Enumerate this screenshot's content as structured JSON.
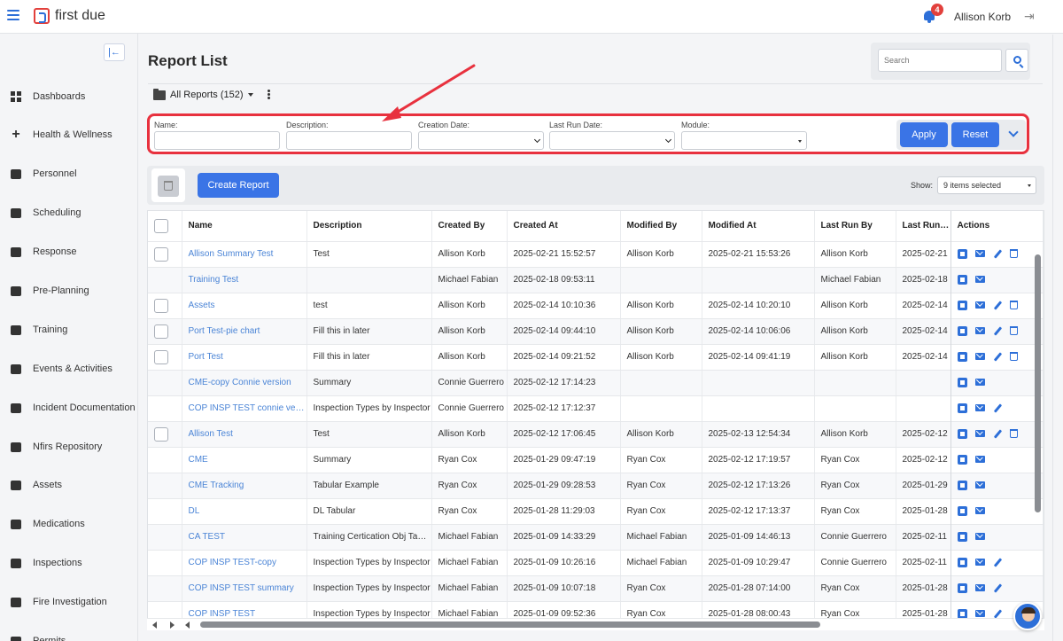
{
  "app": {
    "brand": "first due",
    "user": "Allison Korb",
    "notifications": "4"
  },
  "sidebar": {
    "items": [
      {
        "label": "Dashboards",
        "icon": "dashboard-icon"
      },
      {
        "label": "Health & Wellness",
        "icon": "plus-icon"
      },
      {
        "label": "Personnel",
        "icon": "people-icon"
      },
      {
        "label": "Scheduling",
        "icon": "calendar-icon"
      },
      {
        "label": "Response",
        "icon": "response-icon"
      },
      {
        "label": "Pre-Planning",
        "icon": "map-icon"
      },
      {
        "label": "Training",
        "icon": "training-icon"
      },
      {
        "label": "Events & Activities",
        "icon": "event-icon"
      },
      {
        "label": "Incident Documentation",
        "icon": "document-icon"
      },
      {
        "label": "Nfirs Repository",
        "icon": "repository-icon"
      },
      {
        "label": "Assets",
        "icon": "truck-icon"
      },
      {
        "label": "Medications",
        "icon": "syringe-icon"
      },
      {
        "label": "Inspections",
        "icon": "checklist-icon"
      },
      {
        "label": "Fire Investigation",
        "icon": "investigation-icon"
      },
      {
        "label": "Permits",
        "icon": "permit-icon"
      }
    ]
  },
  "page": {
    "title": "Report List",
    "search_placeholder": "Search",
    "folder": "All Reports (152)"
  },
  "filters": {
    "name_label": "Name:",
    "description_label": "Description:",
    "creation_date_label": "Creation Date:",
    "last_run_date_label": "Last Run Date:",
    "module_label": "Module:",
    "apply": "Apply",
    "reset": "Reset"
  },
  "toolbar": {
    "create": "Create Report",
    "show_label": "Show:",
    "show_value": "9 items selected"
  },
  "table": {
    "headers": [
      "Name",
      "Description",
      "Created By",
      "Created At",
      "Modified By",
      "Modified At",
      "Last Run By",
      "Last Run At",
      "Actions"
    ],
    "rows": [
      {
        "cb": true,
        "name": "Allison Summary Test",
        "desc": "Test",
        "created_by": "Allison Korb",
        "created_at": "2025-02-21 15:52:57",
        "modified_by": "Allison Korb",
        "modified_at": "2025-02-21 15:53:26",
        "last_run_by": "Allison Korb",
        "last_run_at": "2025-02-21",
        "actions": [
          "copy",
          "mail",
          "edit",
          "delete"
        ]
      },
      {
        "cb": false,
        "name": "Training Test",
        "desc": "",
        "created_by": "Michael Fabian",
        "created_at": "2025-02-18 09:53:11",
        "modified_by": "",
        "modified_at": "",
        "last_run_by": "Michael Fabian",
        "last_run_at": "2025-02-18",
        "actions": [
          "copy",
          "mail"
        ]
      },
      {
        "cb": true,
        "name": "Assets",
        "desc": "test",
        "created_by": "Allison Korb",
        "created_at": "2025-02-14 10:10:36",
        "modified_by": "Allison Korb",
        "modified_at": "2025-02-14 10:20:10",
        "last_run_by": "Allison Korb",
        "last_run_at": "2025-02-14",
        "actions": [
          "copy",
          "mail",
          "edit",
          "delete"
        ]
      },
      {
        "cb": true,
        "name": "Port Test-pie chart",
        "desc": "Fill this in later",
        "created_by": "Allison Korb",
        "created_at": "2025-02-14 09:44:10",
        "modified_by": "Allison Korb",
        "modified_at": "2025-02-14 10:06:06",
        "last_run_by": "Allison Korb",
        "last_run_at": "2025-02-14",
        "actions": [
          "copy",
          "mail",
          "edit",
          "delete"
        ]
      },
      {
        "cb": true,
        "name": "Port Test",
        "desc": "Fill this in later",
        "created_by": "Allison Korb",
        "created_at": "2025-02-14 09:21:52",
        "modified_by": "Allison Korb",
        "modified_at": "2025-02-14 09:41:19",
        "last_run_by": "Allison Korb",
        "last_run_at": "2025-02-14",
        "actions": [
          "copy",
          "mail",
          "edit",
          "delete"
        ]
      },
      {
        "cb": false,
        "name": "CME-copy Connie version",
        "desc": "Summary",
        "created_by": "Connie Guerrero",
        "created_at": "2025-02-12 17:14:23",
        "modified_by": "",
        "modified_at": "",
        "last_run_by": "",
        "last_run_at": "",
        "actions": [
          "copy",
          "mail"
        ]
      },
      {
        "cb": false,
        "name": "COP INSP TEST connie version",
        "desc": "Inspection Types by Inspector",
        "created_by": "Connie Guerrero",
        "created_at": "2025-02-12 17:12:37",
        "modified_by": "",
        "modified_at": "",
        "last_run_by": "",
        "last_run_at": "",
        "actions": [
          "copy",
          "mail",
          "edit"
        ]
      },
      {
        "cb": true,
        "name": "Allison Test",
        "desc": "Test",
        "created_by": "Allison Korb",
        "created_at": "2025-02-12 17:06:45",
        "modified_by": "Allison Korb",
        "modified_at": "2025-02-13 12:54:34",
        "last_run_by": "Allison Korb",
        "last_run_at": "2025-02-12",
        "actions": [
          "copy",
          "mail",
          "edit",
          "delete"
        ]
      },
      {
        "cb": false,
        "name": "CME",
        "desc": "Summary",
        "created_by": "Ryan Cox",
        "created_at": "2025-01-29 09:47:19",
        "modified_by": "Ryan Cox",
        "modified_at": "2025-02-12 17:19:57",
        "last_run_by": "Ryan Cox",
        "last_run_at": "2025-02-12",
        "actions": [
          "copy",
          "mail"
        ]
      },
      {
        "cb": false,
        "name": "CME Tracking",
        "desc": "Tabular Example",
        "created_by": "Ryan Cox",
        "created_at": "2025-01-29 09:28:53",
        "modified_by": "Ryan Cox",
        "modified_at": "2025-02-12 17:13:26",
        "last_run_by": "Ryan Cox",
        "last_run_at": "2025-01-29",
        "actions": [
          "copy",
          "mail"
        ]
      },
      {
        "cb": false,
        "name": "DL",
        "desc": "DL Tabular",
        "created_by": "Ryan Cox",
        "created_at": "2025-01-28 11:29:03",
        "modified_by": "Ryan Cox",
        "modified_at": "2025-02-12 17:13:37",
        "last_run_by": "Ryan Cox",
        "last_run_at": "2025-01-28",
        "actions": [
          "copy",
          "mail"
        ]
      },
      {
        "cb": false,
        "name": "CA TEST",
        "desc": "Training Certication Obj Tabular",
        "created_by": "Michael Fabian",
        "created_at": "2025-01-09 14:33:29",
        "modified_by": "Michael Fabian",
        "modified_at": "2025-01-09 14:46:13",
        "last_run_by": "Connie Guerrero",
        "last_run_at": "2025-02-11",
        "actions": [
          "copy",
          "mail"
        ]
      },
      {
        "cb": false,
        "name": "COP INSP TEST-copy",
        "desc": "Inspection Types by Inspector",
        "created_by": "Michael Fabian",
        "created_at": "2025-01-09 10:26:16",
        "modified_by": "Michael Fabian",
        "modified_at": "2025-01-09 10:29:47",
        "last_run_by": "Connie Guerrero",
        "last_run_at": "2025-02-11",
        "actions": [
          "copy",
          "mail",
          "edit"
        ]
      },
      {
        "cb": false,
        "name": "COP INSP TEST summary",
        "desc": "Inspection Types by Inspector",
        "created_by": "Michael Fabian",
        "created_at": "2025-01-09 10:07:18",
        "modified_by": "Ryan Cox",
        "modified_at": "2025-01-28 07:14:00",
        "last_run_by": "Ryan Cox",
        "last_run_at": "2025-01-28",
        "actions": [
          "copy",
          "mail",
          "edit"
        ]
      },
      {
        "cb": false,
        "name": "COP INSP TEST",
        "desc": "Inspection Types by Inspector",
        "created_by": "Michael Fabian",
        "created_at": "2025-01-09 09:52:36",
        "modified_by": "Ryan Cox",
        "modified_at": "2025-01-28 08:00:43",
        "last_run_by": "Ryan Cox",
        "last_run_at": "2025-01-28",
        "actions": [
          "copy",
          "mail",
          "edit"
        ]
      }
    ]
  },
  "colors": {
    "accent": "#3a74e6",
    "highlight": "#e8313e",
    "link": "#4a84d6"
  }
}
